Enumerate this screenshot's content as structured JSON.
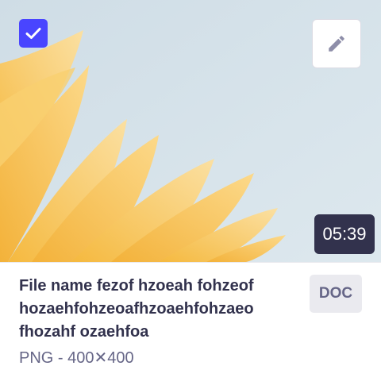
{
  "card": {
    "duration": "05:39",
    "file_name": "File name fezof hzoeah fohzeof hozaehfohzeoafhzoaehfohzaeo fhozahf ozaehfoa",
    "meta": "PNG - 400✕400",
    "type_badge": "DOC",
    "selected": true
  },
  "icons": {
    "checkbox": "check-icon",
    "edit": "pencil-icon"
  },
  "colors": {
    "primary": "#4945ff",
    "badge_dark": "#32324d",
    "text_primary": "#32324d",
    "text_secondary": "#666687",
    "neutral_bg": "#eaeaef",
    "petal": "#f7c75a",
    "sky": "#d6e3ea"
  }
}
